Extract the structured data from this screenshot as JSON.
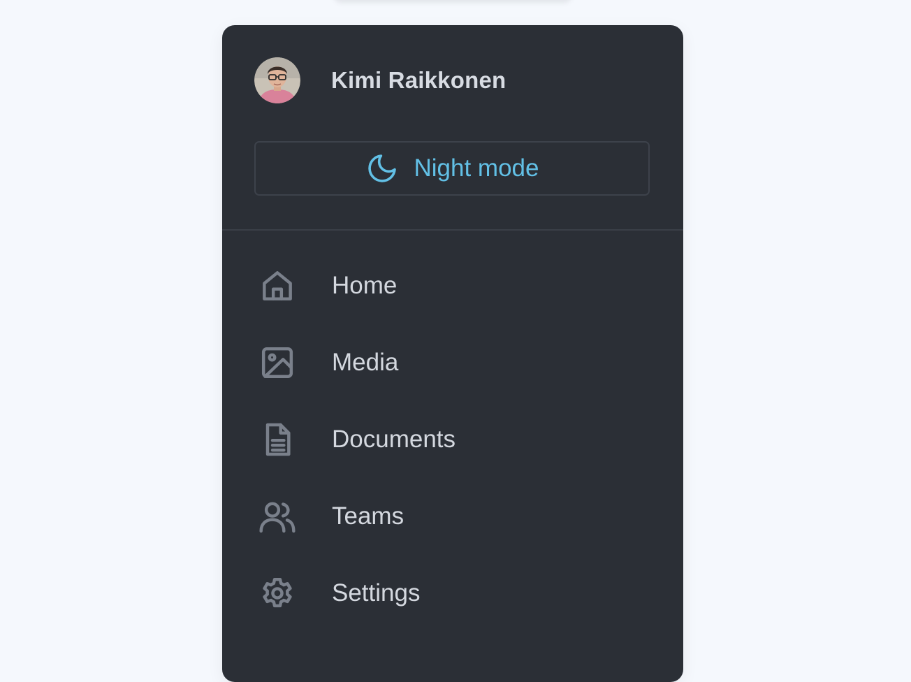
{
  "user": {
    "name": "Kimi Raikkonen",
    "avatar_icon": "user-avatar-photo"
  },
  "theme_toggle": {
    "label": "Night mode",
    "icon": "moon-icon",
    "accent_color": "#62c0e6"
  },
  "nav": {
    "items": [
      {
        "label": "Home",
        "icon": "home-icon"
      },
      {
        "label": "Media",
        "icon": "image-icon"
      },
      {
        "label": "Documents",
        "icon": "document-icon"
      },
      {
        "label": "Teams",
        "icon": "users-icon"
      },
      {
        "label": "Settings",
        "icon": "gear-icon"
      }
    ]
  },
  "colors": {
    "page_background": "#f5f8fd",
    "panel_background": "#2b2f36",
    "icon_color": "#7a808b",
    "text_color": "#d4d8df"
  }
}
